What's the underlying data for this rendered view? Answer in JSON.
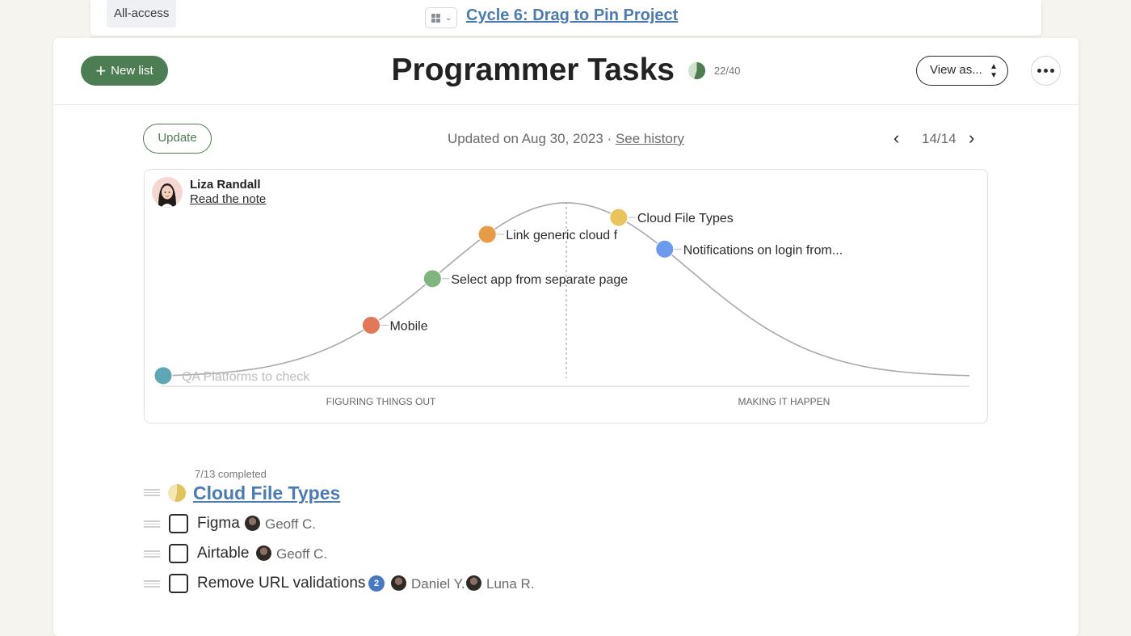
{
  "top_bar": {
    "access_badge": "All-access",
    "project_title": "Cycle 6: Drag to Pin Project"
  },
  "header": {
    "new_list_label": "New list",
    "title": "Programmer Tasks",
    "progress_text": "22/40",
    "progress_fraction": 0.55,
    "view_as_label": "View as..."
  },
  "update_row": {
    "update_label": "Update",
    "updated_text": "Updated on Aug 30, 2023 · ",
    "see_history_label": "See history",
    "pager_text": "14/14"
  },
  "note": {
    "author": "Liza Randall",
    "link_label": "Read the note"
  },
  "chart_data": {
    "type": "scatter",
    "description_axis": "hill chart",
    "x_domain": [
      0,
      100
    ],
    "y_domain": [
      0,
      1
    ],
    "phase_labels": [
      "FIGURING THINGS OUT",
      "MAKING IT HAPPEN"
    ],
    "points": [
      {
        "label": "QA Platforms to check",
        "x": 0,
        "color": "#5fa7b7",
        "faded": true
      },
      {
        "label": "Mobile",
        "x": 25.8,
        "color": "#e0795a",
        "faded": false
      },
      {
        "label": "Select app from separate page",
        "x": 33.4,
        "color": "#7fb57e",
        "faded": false
      },
      {
        "label": "Link generic cloud f",
        "x": 40.2,
        "color": "#e79b45",
        "faded": false
      },
      {
        "label": "Cloud File Types",
        "x": 56.5,
        "color": "#e8c45a",
        "faded": false
      },
      {
        "label": "Notifications on login from...",
        "x": 62.2,
        "color": "#6b9bef",
        "faded": false
      }
    ]
  },
  "task_group": {
    "completed_text": "7/13 completed",
    "title": "Cloud File Types",
    "progress_fraction": 0.54,
    "tasks": [
      {
        "name": "Figma",
        "assignees": [
          "Geoff C."
        ]
      },
      {
        "name": "Airtable",
        "assignees": [
          "Geoff C."
        ]
      },
      {
        "name": "Remove URL validations",
        "comments": "2",
        "assignees": [
          "Daniel Y.",
          "Luna R."
        ]
      }
    ]
  }
}
